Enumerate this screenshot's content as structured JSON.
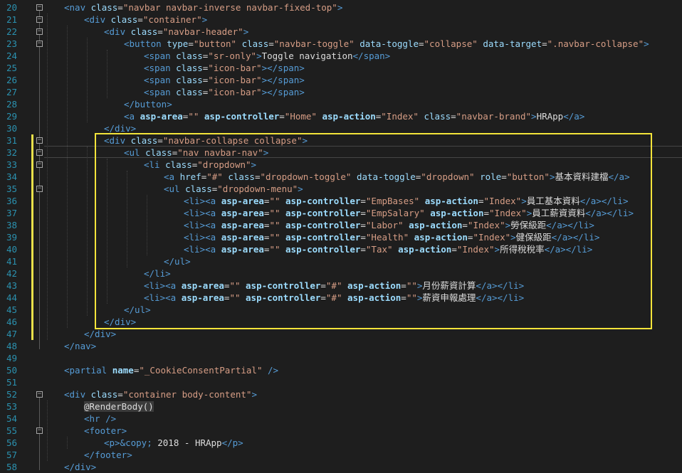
{
  "lines": [
    {
      "n": "20",
      "tokens": [
        [
          "tag",
          "<nav "
        ],
        [
          "attr",
          "class"
        ],
        [
          "txt",
          "="
        ],
        [
          "val",
          "\"navbar navbar-inverse navbar-fixed-top\""
        ],
        [
          "tag",
          ">"
        ]
      ]
    },
    {
      "n": "21",
      "tokens": [
        [
          "tag",
          "<div "
        ],
        [
          "attr",
          "class"
        ],
        [
          "txt",
          "="
        ],
        [
          "val",
          "\"container\""
        ],
        [
          "tag",
          ">"
        ]
      ]
    },
    {
      "n": "22",
      "tokens": [
        [
          "tag",
          "<div "
        ],
        [
          "attr",
          "class"
        ],
        [
          "txt",
          "="
        ],
        [
          "val",
          "\"navbar-header\""
        ],
        [
          "tag",
          ">"
        ]
      ]
    },
    {
      "n": "23",
      "tokens": [
        [
          "tag",
          "<button "
        ],
        [
          "attr",
          "type"
        ],
        [
          "txt",
          "="
        ],
        [
          "val",
          "\"button\" "
        ],
        [
          "attr",
          "class"
        ],
        [
          "txt",
          "="
        ],
        [
          "val",
          "\"navbar-toggle\" "
        ],
        [
          "attr",
          "data-toggle"
        ],
        [
          "txt",
          "="
        ],
        [
          "val",
          "\"collapse\" "
        ],
        [
          "attr",
          "data-target"
        ],
        [
          "txt",
          "="
        ],
        [
          "val",
          "\".navbar-collapse\""
        ],
        [
          "tag",
          ">"
        ]
      ]
    },
    {
      "n": "24",
      "tokens": [
        [
          "tag",
          "<span "
        ],
        [
          "attr",
          "class"
        ],
        [
          "txt",
          "="
        ],
        [
          "val",
          "\"sr-only\""
        ],
        [
          "tag",
          ">"
        ],
        [
          "txt",
          "Toggle navigation"
        ],
        [
          "tag",
          "</span>"
        ]
      ]
    },
    {
      "n": "25",
      "tokens": [
        [
          "tag",
          "<span "
        ],
        [
          "attr",
          "class"
        ],
        [
          "txt",
          "="
        ],
        [
          "val",
          "\"icon-bar\""
        ],
        [
          "tag",
          "></span>"
        ]
      ]
    },
    {
      "n": "26",
      "tokens": [
        [
          "tag",
          "<span "
        ],
        [
          "attr",
          "class"
        ],
        [
          "txt",
          "="
        ],
        [
          "val",
          "\"icon-bar\""
        ],
        [
          "tag",
          "></span>"
        ]
      ]
    },
    {
      "n": "27",
      "tokens": [
        [
          "tag",
          "<span "
        ],
        [
          "attr",
          "class"
        ],
        [
          "txt",
          "="
        ],
        [
          "val",
          "\"icon-bar\""
        ],
        [
          "tag",
          "></span>"
        ]
      ]
    },
    {
      "n": "28",
      "tokens": [
        [
          "tag",
          "</button>"
        ]
      ]
    },
    {
      "n": "29",
      "tokens": [
        [
          "tag",
          "<a "
        ],
        [
          "bold",
          "asp-area"
        ],
        [
          "txt",
          "="
        ],
        [
          "val",
          "\"\" "
        ],
        [
          "bold",
          "asp-controller"
        ],
        [
          "txt",
          "="
        ],
        [
          "val",
          "\"Home\" "
        ],
        [
          "bold",
          "asp-action"
        ],
        [
          "txt",
          "="
        ],
        [
          "val",
          "\"Index\" "
        ],
        [
          "attr",
          "class"
        ],
        [
          "txt",
          "="
        ],
        [
          "val",
          "\"navbar-brand\""
        ],
        [
          "tag",
          ">"
        ],
        [
          "txt",
          "HRApp"
        ],
        [
          "tag",
          "</a>"
        ]
      ]
    },
    {
      "n": "30",
      "tokens": [
        [
          "tag",
          "</div>"
        ]
      ]
    },
    {
      "n": "31",
      "tokens": [
        [
          "tag",
          "<div "
        ],
        [
          "attr",
          "class"
        ],
        [
          "txt",
          "="
        ],
        [
          "val",
          "\"navbar-collapse collapse\""
        ],
        [
          "tag",
          ">"
        ]
      ]
    },
    {
      "n": "32",
      "tokens": [
        [
          "tag",
          "<ul "
        ],
        [
          "attr",
          "class"
        ],
        [
          "txt",
          "="
        ],
        [
          "val",
          "\"nav navbar-nav\""
        ],
        [
          "tag",
          ">"
        ]
      ]
    },
    {
      "n": "33",
      "tokens": [
        [
          "tag",
          "<li "
        ],
        [
          "attr",
          "class"
        ],
        [
          "txt",
          "="
        ],
        [
          "val",
          "\"dropdown\""
        ],
        [
          "tag",
          ">"
        ]
      ]
    },
    {
      "n": "34",
      "tokens": [
        [
          "tag",
          "<a "
        ],
        [
          "attr",
          "href"
        ],
        [
          "txt",
          "="
        ],
        [
          "val",
          "\"#\" "
        ],
        [
          "attr",
          "class"
        ],
        [
          "txt",
          "="
        ],
        [
          "val",
          "\"dropdown-toggle\" "
        ],
        [
          "attr",
          "data-toggle"
        ],
        [
          "txt",
          "="
        ],
        [
          "val",
          "\"dropdown\" "
        ],
        [
          "attr",
          "role"
        ],
        [
          "txt",
          "="
        ],
        [
          "val",
          "\"button\""
        ],
        [
          "tag",
          ">"
        ],
        [
          "txt",
          "基本資料建檔"
        ],
        [
          "tag",
          "</a>"
        ]
      ]
    },
    {
      "n": "35",
      "tokens": [
        [
          "tag",
          "<ul "
        ],
        [
          "attr",
          "class"
        ],
        [
          "txt",
          "="
        ],
        [
          "val",
          "\"dropdown-menu\""
        ],
        [
          "tag",
          ">"
        ]
      ]
    },
    {
      "n": "36",
      "tokens": [
        [
          "tag",
          "<li><a "
        ],
        [
          "bold",
          "asp-area"
        ],
        [
          "txt",
          "="
        ],
        [
          "val",
          "\"\" "
        ],
        [
          "bold",
          "asp-controller"
        ],
        [
          "txt",
          "="
        ],
        [
          "val",
          "\"EmpBases\" "
        ],
        [
          "bold",
          "asp-action"
        ],
        [
          "txt",
          "="
        ],
        [
          "val",
          "\"Index\""
        ],
        [
          "tag",
          ">"
        ],
        [
          "txt",
          "員工基本資料"
        ],
        [
          "tag",
          "</a></li>"
        ]
      ]
    },
    {
      "n": "37",
      "tokens": [
        [
          "tag",
          "<li><a "
        ],
        [
          "bold",
          "asp-area"
        ],
        [
          "txt",
          "="
        ],
        [
          "val",
          "\"\" "
        ],
        [
          "bold",
          "asp-controller"
        ],
        [
          "txt",
          "="
        ],
        [
          "val",
          "\"EmpSalary\" "
        ],
        [
          "bold",
          "asp-action"
        ],
        [
          "txt",
          "="
        ],
        [
          "val",
          "\"Index\""
        ],
        [
          "tag",
          ">"
        ],
        [
          "txt",
          "員工薪資資料"
        ],
        [
          "tag",
          "</a></li>"
        ]
      ]
    },
    {
      "n": "38",
      "tokens": [
        [
          "tag",
          "<li><a "
        ],
        [
          "bold",
          "asp-area"
        ],
        [
          "txt",
          "="
        ],
        [
          "val",
          "\"\" "
        ],
        [
          "bold",
          "asp-controller"
        ],
        [
          "txt",
          "="
        ],
        [
          "val",
          "\"Labor\" "
        ],
        [
          "bold",
          "asp-action"
        ],
        [
          "txt",
          "="
        ],
        [
          "val",
          "\"Index\""
        ],
        [
          "tag",
          ">"
        ],
        [
          "txt",
          "勞保級距"
        ],
        [
          "tag",
          "</a></li>"
        ]
      ]
    },
    {
      "n": "39",
      "tokens": [
        [
          "tag",
          "<li><a "
        ],
        [
          "bold",
          "asp-area"
        ],
        [
          "txt",
          "="
        ],
        [
          "val",
          "\"\" "
        ],
        [
          "bold",
          "asp-controller"
        ],
        [
          "txt",
          "="
        ],
        [
          "val",
          "\"Health\" "
        ],
        [
          "bold",
          "asp-action"
        ],
        [
          "txt",
          "="
        ],
        [
          "val",
          "\"Index\""
        ],
        [
          "tag",
          ">"
        ],
        [
          "txt",
          "健保級距"
        ],
        [
          "tag",
          "</a></li>"
        ]
      ]
    },
    {
      "n": "40",
      "tokens": [
        [
          "tag",
          "<li><a "
        ],
        [
          "bold",
          "asp-area"
        ],
        [
          "txt",
          "="
        ],
        [
          "val",
          "\"\" "
        ],
        [
          "bold",
          "asp-controller"
        ],
        [
          "txt",
          "="
        ],
        [
          "val",
          "\"Tax\" "
        ],
        [
          "bold",
          "asp-action"
        ],
        [
          "txt",
          "="
        ],
        [
          "val",
          "\"Index\""
        ],
        [
          "tag",
          ">"
        ],
        [
          "txt",
          "所得稅稅率"
        ],
        [
          "tag",
          "</a></li>"
        ]
      ]
    },
    {
      "n": "41",
      "tokens": [
        [
          "tag",
          "</ul>"
        ]
      ]
    },
    {
      "n": "42",
      "tokens": [
        [
          "tag",
          "</li>"
        ]
      ]
    },
    {
      "n": "43",
      "tokens": [
        [
          "tag",
          "<li><a "
        ],
        [
          "bold",
          "asp-area"
        ],
        [
          "txt",
          "="
        ],
        [
          "val",
          "\"\" "
        ],
        [
          "bold",
          "asp-controller"
        ],
        [
          "txt",
          "="
        ],
        [
          "val",
          "\"#\" "
        ],
        [
          "bold",
          "asp-action"
        ],
        [
          "txt",
          "="
        ],
        [
          "val",
          "\"\""
        ],
        [
          "tag",
          ">"
        ],
        [
          "txt",
          "月份薪資計算"
        ],
        [
          "tag",
          "</a></li>"
        ]
      ]
    },
    {
      "n": "44",
      "tokens": [
        [
          "tag",
          "<li><a "
        ],
        [
          "bold",
          "asp-area"
        ],
        [
          "txt",
          "="
        ],
        [
          "val",
          "\"\" "
        ],
        [
          "bold",
          "asp-controller"
        ],
        [
          "txt",
          "="
        ],
        [
          "val",
          "\"#\" "
        ],
        [
          "bold",
          "asp-action"
        ],
        [
          "txt",
          "="
        ],
        [
          "val",
          "\"\""
        ],
        [
          "tag",
          ">"
        ],
        [
          "txt",
          "薪資申報處理"
        ],
        [
          "tag",
          "</a></li>"
        ]
      ]
    },
    {
      "n": "45",
      "tokens": [
        [
          "tag",
          "</ul>"
        ]
      ]
    },
    {
      "n": "46",
      "tokens": [
        [
          "tag",
          "</div>"
        ]
      ]
    },
    {
      "n": "47",
      "tokens": [
        [
          "tag",
          "</div>"
        ]
      ]
    },
    {
      "n": "48",
      "tokens": [
        [
          "tag",
          "</nav>"
        ]
      ]
    },
    {
      "n": "49",
      "tokens": []
    },
    {
      "n": "50",
      "tokens": [
        [
          "tag",
          "<partial "
        ],
        [
          "bold",
          "name"
        ],
        [
          "txt",
          "="
        ],
        [
          "val",
          "\"_CookieConsentPartial\" "
        ],
        [
          "tag",
          "/>"
        ]
      ]
    },
    {
      "n": "51",
      "tokens": []
    },
    {
      "n": "52",
      "tokens": [
        [
          "tag",
          "<div "
        ],
        [
          "attr",
          "class"
        ],
        [
          "txt",
          "="
        ],
        [
          "val",
          "\"container body-content\""
        ],
        [
          "tag",
          ">"
        ]
      ]
    },
    {
      "n": "53",
      "tokens": [
        [
          "razor",
          "@RenderBody()"
        ]
      ]
    },
    {
      "n": "54",
      "tokens": [
        [
          "tag",
          "<hr />"
        ]
      ]
    },
    {
      "n": "55",
      "tokens": [
        [
          "tag",
          "<footer>"
        ]
      ]
    },
    {
      "n": "56",
      "tokens": [
        [
          "tag",
          "<p>"
        ],
        [
          "ent",
          "&copy;"
        ],
        [
          "txt",
          " 2018 - HRApp"
        ],
        [
          "tag",
          "</p>"
        ]
      ]
    },
    {
      "n": "57",
      "tokens": [
        [
          "tag",
          "</footer>"
        ]
      ]
    },
    {
      "n": "58",
      "tokens": [
        [
          "tag",
          "</div>"
        ]
      ]
    }
  ],
  "colors": {
    "background": "#1e1e1e",
    "line_number": "#2b91af",
    "tag": "#569cd6",
    "attribute": "#9cdcfe",
    "string": "#d69d85",
    "text": "#dcdcdc",
    "selection_box": "#f3e43a",
    "change_marker": "#e8e04a"
  }
}
